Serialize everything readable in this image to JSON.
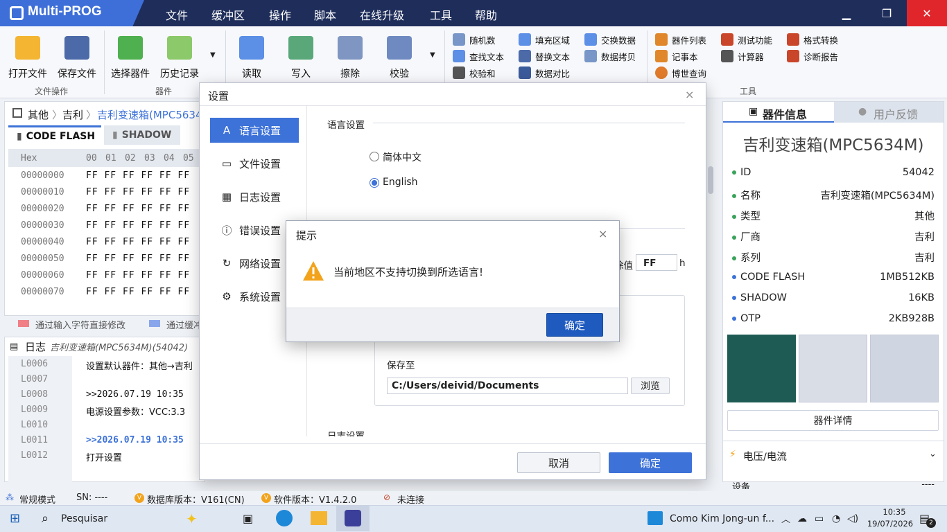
{
  "app": {
    "title": "Multi-PROG"
  },
  "menu": [
    "文件",
    "缓冲区",
    "操作",
    "脚本",
    "在线升级",
    "工具",
    "帮助"
  ],
  "ribbon": {
    "big": [
      "打开文件",
      "保存文件",
      "选择器件",
      "历史记录",
      "读取",
      "写入",
      "擦除",
      "校验"
    ],
    "groups": [
      "文件操作",
      "器件",
      "工具"
    ],
    "small1": [
      "随机数",
      "查找文本",
      "校验和"
    ],
    "small2": [
      "填充区域",
      "替换文本",
      "数据对比"
    ],
    "small3": [
      "交换数据",
      "数据拷贝"
    ],
    "small4": [
      "器件列表",
      "记事本",
      "博世查询"
    ],
    "small5": [
      "测试功能",
      "计算器"
    ],
    "small6": [
      "格式转换",
      "诊断报告"
    ]
  },
  "breadcrumb": [
    "其他",
    "吉利",
    "吉利变速箱(MPC5634"
  ],
  "buffer_tabs": [
    "CODE FLASH",
    "SHADOW"
  ],
  "hex": {
    "header": "Hex",
    "cols": [
      "00",
      "01",
      "02",
      "03",
      "04",
      "05"
    ],
    "rows": [
      "00000000",
      "00000010",
      "00000020",
      "00000030",
      "00000040",
      "00000050",
      "00000060",
      "00000070"
    ],
    "cell": "FF FF FF FF FF FF"
  },
  "legend": [
    "通过输入字符直接修改",
    "通过缓冲"
  ],
  "log": {
    "title": "日志",
    "subtitle": "吉利变速箱(MPC5634M)(54042)",
    "lines": [
      {
        "n": "L0006",
        "t": "设置默认器件：其他→吉利"
      },
      {
        "n": "L0007",
        "t": ""
      },
      {
        "n": "L0008",
        "t": ">>2026.07.19 10:35"
      },
      {
        "n": "L0009",
        "t": "电源设置参数：VCC:3.3"
      },
      {
        "n": "L0010",
        "t": ""
      },
      {
        "n": "L0011",
        "t": ">>2026.07.19 10:35"
      },
      {
        "n": "L0012",
        "t": "打开设置"
      }
    ]
  },
  "device": {
    "tab_info": "器件信息",
    "tab_feedback": "用户反馈",
    "name": "吉利变速箱(MPC5634M)",
    "props": [
      {
        "k": "ID",
        "v": "54042",
        "c": "g"
      },
      {
        "k": "名称",
        "v": "吉利变速箱(MPC5634M)",
        "c": "g"
      },
      {
        "k": "类型",
        "v": "其他",
        "c": "g"
      },
      {
        "k": "厂商",
        "v": "吉利",
        "c": "g"
      },
      {
        "k": "系列",
        "v": "吉利",
        "c": "g"
      },
      {
        "k": "CODE FLASH",
        "v": "1MB512KB",
        "c": "b"
      },
      {
        "k": "SHADOW",
        "v": "16KB",
        "c": "b"
      },
      {
        "k": "OTP",
        "v": "2KB928B",
        "c": "b"
      }
    ],
    "detail_button": "器件详情",
    "voltage_title": "电压/电流",
    "device_row": "设备",
    "device_row_val": "----"
  },
  "settings": {
    "title": "设置",
    "nav": [
      "语言设置",
      "文件设置",
      "日志设置",
      "错误设置",
      "网络设置",
      "系统设置"
    ],
    "section": "语言设置",
    "lang_options": [
      "简体中文",
      "English"
    ],
    "erase_label": "除值",
    "erase_value": "FF",
    "erase_unit": "h",
    "save_label": "保存至",
    "save_path": "C:/Users/deivid/Documents",
    "browse": "浏览",
    "section2": "日志设置",
    "cancel": "取消",
    "ok": "确定"
  },
  "alert": {
    "title": "提示",
    "message": "当前地区不支持切换到所选语言!",
    "ok": "确定"
  },
  "status": {
    "mode": "常规模式",
    "sn": "SN: ----",
    "db": "数据库版本：V161(CN)",
    "sw": "软件版本：V1.4.2.0",
    "conn": "未连接"
  },
  "taskbar": {
    "search": "Pesquisar",
    "news": "Como Kim Jong-un f...",
    "time": "10:35",
    "date": "19/07/2026",
    "notif": "2"
  },
  "colors": {
    "accent": "#3d72d8",
    "titlebar": "#1e2d5a",
    "close": "#e0262b",
    "warning": "#f2a31b"
  }
}
